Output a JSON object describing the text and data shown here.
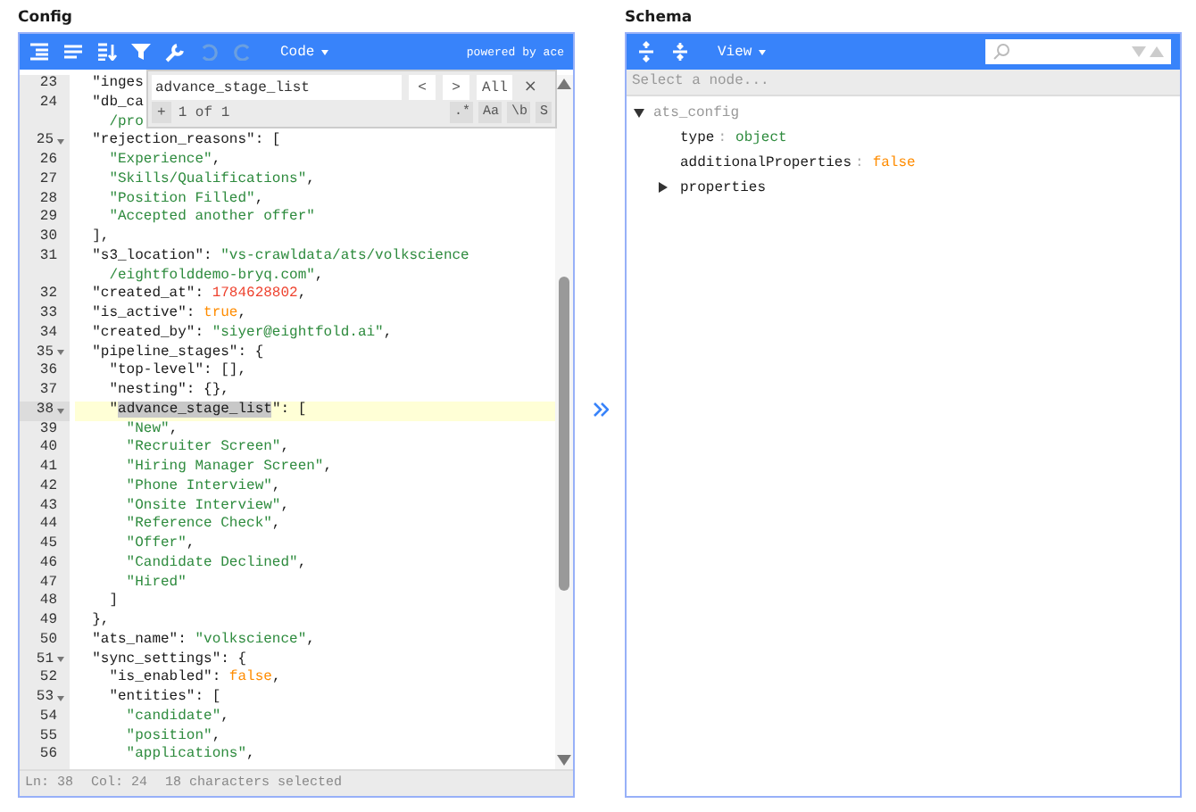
{
  "config": {
    "title": "Config",
    "toolbar": {
      "mode": "Code",
      "powered": "powered by ace"
    },
    "search": {
      "value": "advance_stage_list",
      "prev": "<",
      "next": ">",
      "all": "All",
      "close": "×",
      "expand": "+",
      "count": "1 of 1",
      "options": [
        ".*",
        "Aa",
        "\\b",
        "S"
      ]
    },
    "lines": [
      {
        "no": "23",
        "fold": false,
        "active": false,
        "parts": [
          {
            "kind": "key",
            "text": "  \"inges"
          }
        ]
      },
      {
        "no": "24",
        "fold": false,
        "active": false,
        "parts": [
          {
            "kind": "key",
            "text": "  \"db_ca"
          }
        ]
      },
      {
        "fold": false,
        "active": false,
        "parts": [
          {
            "kind": "str",
            "text": "    /pro"
          }
        ]
      },
      {
        "no": "25",
        "fold": true,
        "active": false,
        "parts": [
          {
            "kind": "key",
            "text": "  \"rejection_reasons\""
          },
          {
            "kind": "punct",
            "text": ": ["
          }
        ]
      },
      {
        "no": "26",
        "fold": false,
        "active": false,
        "parts": [
          {
            "kind": "str",
            "text": "    \"Experience\""
          },
          {
            "kind": "punct",
            "text": ","
          }
        ]
      },
      {
        "no": "27",
        "fold": false,
        "active": false,
        "parts": [
          {
            "kind": "str",
            "text": "    \"Skills/Qualifications\""
          },
          {
            "kind": "punct",
            "text": ","
          }
        ]
      },
      {
        "no": "28",
        "fold": false,
        "active": false,
        "parts": [
          {
            "kind": "str",
            "text": "    \"Position Filled\""
          },
          {
            "kind": "punct",
            "text": ","
          }
        ]
      },
      {
        "no": "29",
        "fold": false,
        "active": false,
        "parts": [
          {
            "kind": "str",
            "text": "    \"Accepted another offer\""
          }
        ]
      },
      {
        "no": "30",
        "fold": false,
        "active": false,
        "parts": [
          {
            "kind": "punct",
            "text": "  ],"
          }
        ]
      },
      {
        "no": "31",
        "fold": false,
        "active": false,
        "parts": [
          {
            "kind": "key",
            "text": "  \"s3_location\""
          },
          {
            "kind": "punct",
            "text": ": "
          },
          {
            "kind": "str",
            "text": "\"vs-crawldata/ats/volkscience"
          }
        ]
      },
      {
        "fold": false,
        "active": false,
        "parts": [
          {
            "kind": "str",
            "text": "    /eightfolddemo-bryq.com\""
          },
          {
            "kind": "punct",
            "text": ","
          }
        ]
      },
      {
        "no": "32",
        "fold": false,
        "active": false,
        "parts": [
          {
            "kind": "key",
            "text": "  \"created_at\""
          },
          {
            "kind": "punct",
            "text": ": "
          },
          {
            "kind": "num",
            "text": "1784628802"
          },
          {
            "kind": "punct",
            "text": ","
          }
        ]
      },
      {
        "no": "33",
        "fold": false,
        "active": false,
        "parts": [
          {
            "kind": "key",
            "text": "  \"is_active\""
          },
          {
            "kind": "punct",
            "text": ": "
          },
          {
            "kind": "bool",
            "text": "true"
          },
          {
            "kind": "punct",
            "text": ","
          }
        ]
      },
      {
        "no": "34",
        "fold": false,
        "active": false,
        "parts": [
          {
            "kind": "key",
            "text": "  \"created_by\""
          },
          {
            "kind": "punct",
            "text": ": "
          },
          {
            "kind": "str",
            "text": "\"siyer@eightfold.ai\""
          },
          {
            "kind": "punct",
            "text": ","
          }
        ]
      },
      {
        "no": "35",
        "fold": true,
        "active": false,
        "parts": [
          {
            "kind": "key",
            "text": "  \"pipeline_stages\""
          },
          {
            "kind": "punct",
            "text": ": {"
          }
        ]
      },
      {
        "no": "36",
        "fold": false,
        "active": false,
        "parts": [
          {
            "kind": "key",
            "text": "    \"top-level\""
          },
          {
            "kind": "punct",
            "text": ": [],"
          }
        ]
      },
      {
        "no": "37",
        "fold": false,
        "active": false,
        "parts": [
          {
            "kind": "key",
            "text": "    \"nesting\""
          },
          {
            "kind": "punct",
            "text": ": {},"
          }
        ]
      },
      {
        "no": "38",
        "fold": true,
        "active": true,
        "parts": [
          {
            "kind": "key",
            "text": "    \""
          },
          {
            "kind": "selection",
            "text": "advance_stage_list"
          },
          {
            "kind": "key",
            "text": "\""
          },
          {
            "kind": "punct",
            "text": ": ["
          }
        ]
      },
      {
        "no": "39",
        "fold": false,
        "active": false,
        "parts": [
          {
            "kind": "str",
            "text": "      \"New\""
          },
          {
            "kind": "punct",
            "text": ","
          }
        ]
      },
      {
        "no": "40",
        "fold": false,
        "active": false,
        "parts": [
          {
            "kind": "str",
            "text": "      \"Recruiter Screen\""
          },
          {
            "kind": "punct",
            "text": ","
          }
        ]
      },
      {
        "no": "41",
        "fold": false,
        "active": false,
        "parts": [
          {
            "kind": "str",
            "text": "      \"Hiring Manager Screen\""
          },
          {
            "kind": "punct",
            "text": ","
          }
        ]
      },
      {
        "no": "42",
        "fold": false,
        "active": false,
        "parts": [
          {
            "kind": "str",
            "text": "      \"Phone Interview\""
          },
          {
            "kind": "punct",
            "text": ","
          }
        ]
      },
      {
        "no": "43",
        "fold": false,
        "active": false,
        "parts": [
          {
            "kind": "str",
            "text": "      \"Onsite Interview\""
          },
          {
            "kind": "punct",
            "text": ","
          }
        ]
      },
      {
        "no": "44",
        "fold": false,
        "active": false,
        "parts": [
          {
            "kind": "str",
            "text": "      \"Reference Check\""
          },
          {
            "kind": "punct",
            "text": ","
          }
        ]
      },
      {
        "no": "45",
        "fold": false,
        "active": false,
        "parts": [
          {
            "kind": "str",
            "text": "      \"Offer\""
          },
          {
            "kind": "punct",
            "text": ","
          }
        ]
      },
      {
        "no": "46",
        "fold": false,
        "active": false,
        "parts": [
          {
            "kind": "str",
            "text": "      \"Candidate Declined\""
          },
          {
            "kind": "punct",
            "text": ","
          }
        ]
      },
      {
        "no": "47",
        "fold": false,
        "active": false,
        "parts": [
          {
            "kind": "str",
            "text": "      \"Hired\""
          }
        ]
      },
      {
        "no": "48",
        "fold": false,
        "active": false,
        "parts": [
          {
            "kind": "punct",
            "text": "    ]"
          }
        ]
      },
      {
        "no": "49",
        "fold": false,
        "active": false,
        "parts": [
          {
            "kind": "punct",
            "text": "  },"
          }
        ]
      },
      {
        "no": "50",
        "fold": false,
        "active": false,
        "parts": [
          {
            "kind": "key",
            "text": "  \"ats_name\""
          },
          {
            "kind": "punct",
            "text": ": "
          },
          {
            "kind": "str",
            "text": "\"volkscience\""
          },
          {
            "kind": "punct",
            "text": ","
          }
        ]
      },
      {
        "no": "51",
        "fold": true,
        "active": false,
        "parts": [
          {
            "kind": "key",
            "text": "  \"sync_settings\""
          },
          {
            "kind": "punct",
            "text": ": {"
          }
        ]
      },
      {
        "no": "52",
        "fold": false,
        "active": false,
        "parts": [
          {
            "kind": "key",
            "text": "    \"is_enabled\""
          },
          {
            "kind": "punct",
            "text": ": "
          },
          {
            "kind": "bool",
            "text": "false"
          },
          {
            "kind": "punct",
            "text": ","
          }
        ]
      },
      {
        "no": "53",
        "fold": true,
        "active": false,
        "parts": [
          {
            "kind": "key",
            "text": "    \"entities\""
          },
          {
            "kind": "punct",
            "text": ": ["
          }
        ]
      },
      {
        "no": "54",
        "fold": false,
        "active": false,
        "parts": [
          {
            "kind": "str",
            "text": "      \"candidate\""
          },
          {
            "kind": "punct",
            "text": ","
          }
        ]
      },
      {
        "no": "55",
        "fold": false,
        "active": false,
        "parts": [
          {
            "kind": "str",
            "text": "      \"position\""
          },
          {
            "kind": "punct",
            "text": ","
          }
        ]
      },
      {
        "no": "56",
        "fold": false,
        "active": false,
        "parts": [
          {
            "kind": "str",
            "text": "      \"applications\""
          },
          {
            "kind": "punct",
            "text": ","
          }
        ]
      }
    ],
    "status": {
      "line": "Ln: 38",
      "col": "Col: 24",
      "selection": "18 characters selected"
    }
  },
  "schema": {
    "title": "Schema",
    "toolbar": {
      "view": "View"
    },
    "path_placeholder": "Select a node...",
    "tree": [
      {
        "kind": "node",
        "name": "ats_config",
        "expanded": true,
        "children": [
          {
            "kind": "string",
            "key": "type",
            "separator": ":",
            "value": "object"
          },
          {
            "kind": "boolean",
            "key": "additionalProperties",
            "separator": ":",
            "value": "false"
          },
          {
            "kind": "node",
            "name": "properties",
            "expanded": false
          }
        ]
      }
    ]
  }
}
